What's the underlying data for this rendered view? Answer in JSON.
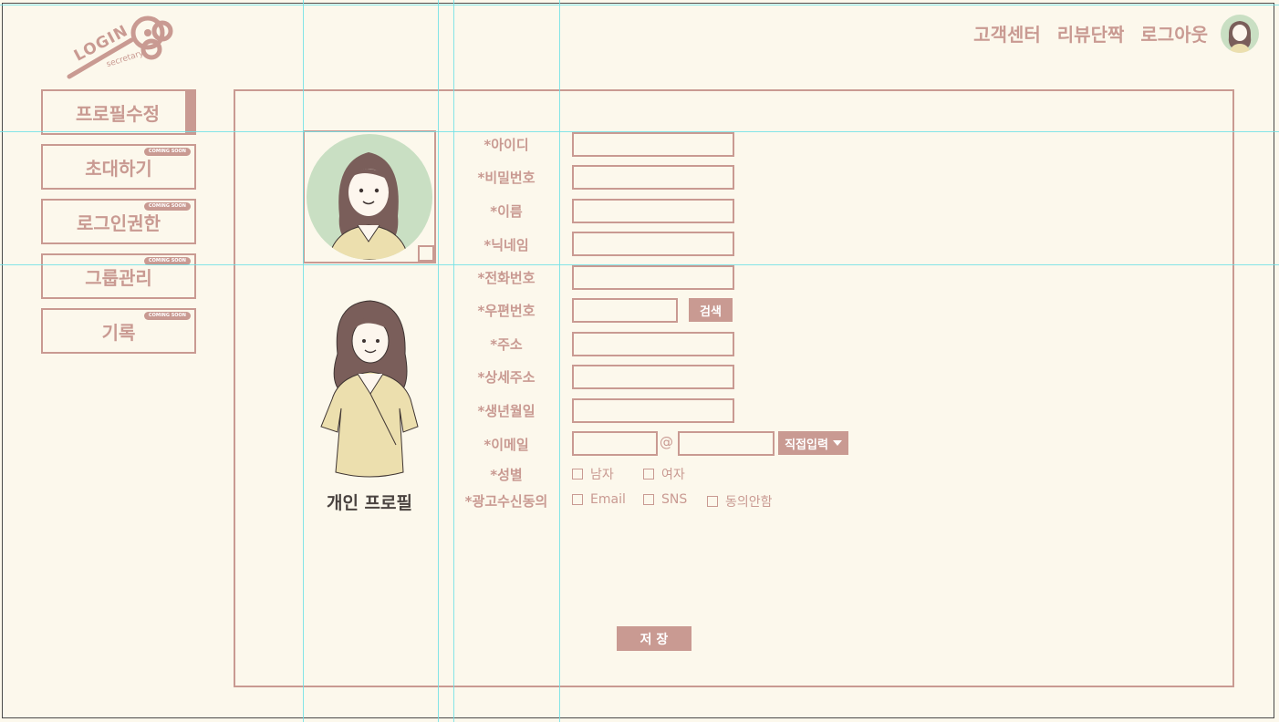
{
  "logo": {
    "text": "LOGIN",
    "sub": "secretary"
  },
  "topnav": {
    "customer_center": "고객센터",
    "review": "리뷰단짝",
    "logout": "로그아웃"
  },
  "sidebar": {
    "items": [
      {
        "label": "프로필수정",
        "badge": ""
      },
      {
        "label": "초대하기",
        "badge": "COMING SOON"
      },
      {
        "label": "로그인권한",
        "badge": "COMING SOON"
      },
      {
        "label": "그룹관리",
        "badge": "COMING SOON"
      },
      {
        "label": "기록",
        "badge": "COMING SOON"
      }
    ]
  },
  "profile": {
    "caption": "개인 프로필"
  },
  "form": {
    "id_label": "*아이디",
    "password_label": "*비밀번호",
    "name_label": "*이름",
    "nickname_label": "*닉네임",
    "phone_label": "*전화번호",
    "zipcode_label": "*우편번호",
    "zipcode_search": "검색",
    "address_label": "*주소",
    "address_detail_label": "*상세주소",
    "birth_label": "*생년월일",
    "email_label": "*이메일",
    "email_at": "@",
    "email_domain_select": "직접입력",
    "gender_label": "*성별",
    "gender_options": [
      "남자",
      "여자"
    ],
    "ad_label": "*광고수신동의",
    "ad_options": [
      "Email",
      "SNS",
      "동의안함"
    ],
    "save_label": "저 장"
  }
}
